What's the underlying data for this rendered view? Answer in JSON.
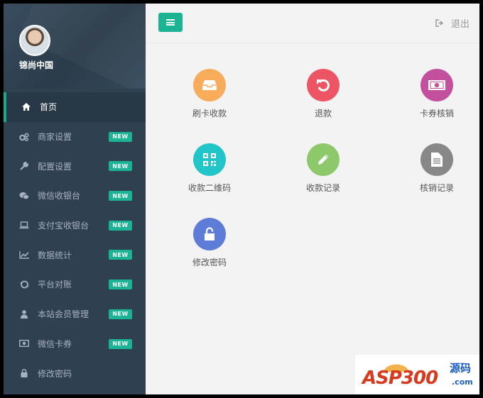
{
  "user": {
    "name": "锦尚中国"
  },
  "menu": [
    {
      "label": "首页",
      "icon": "home-icon",
      "badge": ""
    },
    {
      "label": "商家设置",
      "icon": "cogs-icon",
      "badge": "NEW"
    },
    {
      "label": "配置设置",
      "icon": "wrench-icon",
      "badge": "NEW"
    },
    {
      "label": "微信收银台",
      "icon": "wechat-icon",
      "badge": "NEW"
    },
    {
      "label": "支付宝收银台",
      "icon": "laptop-icon",
      "badge": "NEW"
    },
    {
      "label": "数据统计",
      "icon": "line-chart-icon",
      "badge": "NEW"
    },
    {
      "label": "平台对账",
      "icon": "refresh-icon",
      "badge": "NEW"
    },
    {
      "label": "本站会员管理",
      "icon": "user-icon",
      "badge": "NEW"
    },
    {
      "label": "微信卡券",
      "icon": "money-icon",
      "badge": "NEW"
    },
    {
      "label": "修改密码",
      "icon": "lock-icon",
      "badge": ""
    }
  ],
  "topbar": {
    "logout": "退出"
  },
  "tiles": [
    {
      "label": "刷卡收款",
      "icon": "inbox-icon",
      "color": "#f8ac59"
    },
    {
      "label": "退款",
      "icon": "undo-icon",
      "color": "#ed5565"
    },
    {
      "label": "卡券核销",
      "icon": "money-icon",
      "color": "#c2509d"
    },
    {
      "label": "收款二维码",
      "icon": "qrcode-icon",
      "color": "#23c6c8"
    },
    {
      "label": "收款记录",
      "icon": "pencil-icon",
      "color": "#8dc86a"
    },
    {
      "label": "核销记录",
      "icon": "file-icon",
      "color": "#888888"
    },
    {
      "label": "修改密码",
      "icon": "unlock-icon",
      "color": "#5c7cd8"
    }
  ],
  "watermark": {
    "text": "ASP300",
    "cn": "源码",
    "domain": ".com"
  }
}
